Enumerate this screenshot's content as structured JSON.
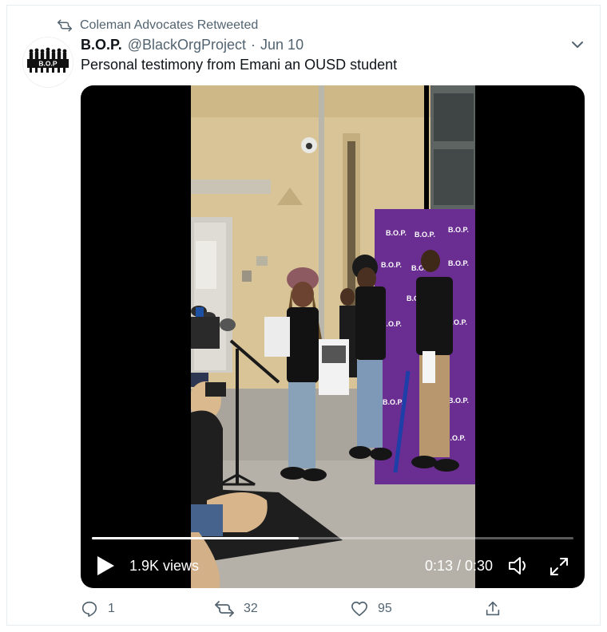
{
  "retweet_context": {
    "text": "Coleman Advocates Retweeted",
    "icon": "retweet-icon"
  },
  "author": {
    "name": "B.O.P.",
    "handle": "@BlackOrgProject",
    "separator": "·",
    "date": "Jun 10",
    "avatar_text": "B.O.P"
  },
  "tweet": {
    "text": "Personal testimony from Emani an OUSD student"
  },
  "video": {
    "views": "1.9K views",
    "time": "0:13 / 0:30",
    "progress": 0.43
  },
  "backdrop": {
    "logo_text": "B.O.P.",
    "color": "#6a2d91"
  },
  "actions": {
    "reply_count": "1",
    "retweet_count": "32",
    "like_count": "95"
  },
  "colors": {
    "accent": "#1d9bf0",
    "muted": "#536471"
  }
}
